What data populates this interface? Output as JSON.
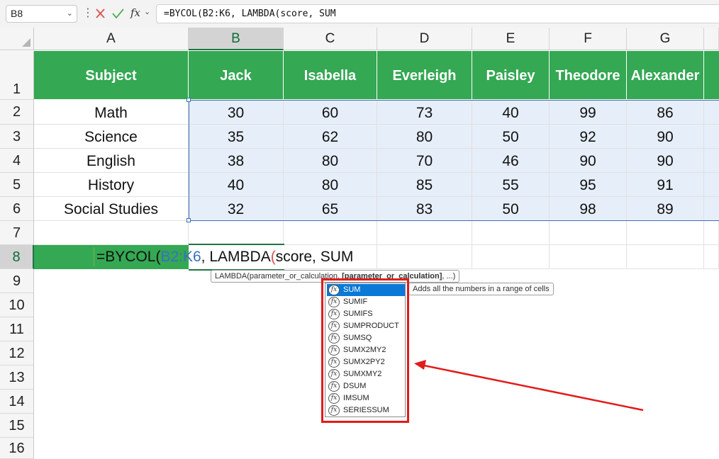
{
  "formula_bar": {
    "name_box": "B8",
    "fx_label": "fx",
    "formula": "=BYCOL(B2:K6, LAMBDA(score, SUM"
  },
  "columns": [
    "A",
    "B",
    "C",
    "D",
    "E",
    "F",
    "G"
  ],
  "rows": [
    "1",
    "2",
    "3",
    "4",
    "5",
    "6",
    "7",
    "8",
    "9",
    "10",
    "11",
    "12",
    "13",
    "14",
    "15",
    "16"
  ],
  "table": {
    "headers": [
      "Subject",
      "Jack",
      "Isabella",
      "Everleigh",
      "Paisley",
      "Theodore",
      "Alexander"
    ],
    "data": [
      [
        "Math",
        "30",
        "60",
        "73",
        "40",
        "99",
        "86"
      ],
      [
        "Science",
        "35",
        "62",
        "80",
        "50",
        "92",
        "90"
      ],
      [
        "English",
        "38",
        "80",
        "70",
        "46",
        "90",
        "90"
      ],
      [
        "History",
        "40",
        "80",
        "85",
        "55",
        "95",
        "91"
      ],
      [
        "Social Studies",
        "32",
        "65",
        "83",
        "50",
        "98",
        "89"
      ]
    ]
  },
  "edit_cell": {
    "prefix": "=BYCOL(",
    "ref": "B2:K6",
    "middle": ", LAMBDA",
    "paren": "(",
    "suffix": "score, SUM"
  },
  "tooltip": {
    "start": "LAMBDA(parameter_or_calculation, ",
    "bold": "[parameter_or_calculation]",
    "end": ", ...)"
  },
  "autocomplete": {
    "items": [
      "SUM",
      "SUMIF",
      "SUMIFS",
      "SUMPRODUCT",
      "SUMSQ",
      "SUMX2MY2",
      "SUMX2PY2",
      "SUMXMY2",
      "DSUM",
      "IMSUM",
      "SERIESSUM"
    ],
    "description": "Adds all the numbers in a range of cells",
    "icon_label": "fx"
  },
  "colors": {
    "header_fill": "#34a853",
    "selection_fill": "#e6eef9",
    "annotation_red": "#e31b1b"
  }
}
